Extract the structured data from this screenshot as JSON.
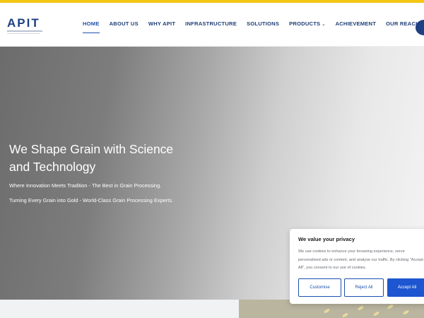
{
  "brand": {
    "logo_text": "APIT",
    "accent_color": "#f3c613",
    "primary_color": "#1d3f84"
  },
  "nav": {
    "items": [
      {
        "label": "HOME",
        "active": true
      },
      {
        "label": "ABOUT US"
      },
      {
        "label": "WHY APIT"
      },
      {
        "label": "INFRASTRUCTURE"
      },
      {
        "label": "SOLUTIONS"
      },
      {
        "label": "PRODUCTS",
        "has_dropdown": true
      },
      {
        "label": "ACHIEVEMENT"
      },
      {
        "label": "OUR REACH"
      }
    ],
    "dropdown_icon": "chevron-down-icon"
  },
  "hero": {
    "title_line1": "We Shape Grain with Science",
    "title_line2": "and Technology",
    "tagline1": "Where Innovation Meets Tradition - The Best in Grain Processing.",
    "tagline2": "Turning Every Grain into Gold - World-Class Grain Processing Experts."
  },
  "cookie_banner": {
    "title": "We value your privacy",
    "body": "We use cookies to enhance your browsing experience, serve personalised ads or content, and analyse our traffic. By clicking \"Accept All\", you consent to our use of cookies.",
    "customise_label": "Customise",
    "reject_label": "Reject All",
    "accept_label": "Accept All",
    "button_color": "#1d56d0"
  }
}
